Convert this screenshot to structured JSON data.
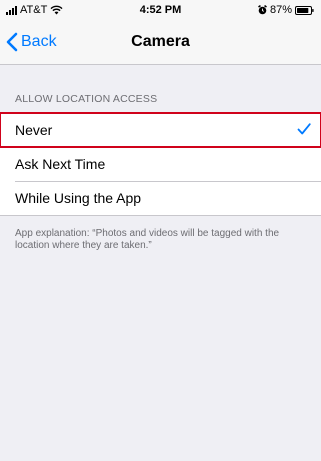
{
  "status_bar": {
    "carrier": "AT&T",
    "time": "4:52 PM",
    "battery_percent": "87%",
    "battery_level": 0.87
  },
  "nav": {
    "back_label": "Back",
    "title": "Camera"
  },
  "section": {
    "header": "ALLOW LOCATION ACCESS"
  },
  "options": [
    {
      "label": "Never",
      "selected": true
    },
    {
      "label": "Ask Next Time",
      "selected": false
    },
    {
      "label": "While Using the App",
      "selected": false
    }
  ],
  "footer": {
    "explanation": "App explanation: “Photos and videos will be tagged with the location where they are taken.”"
  },
  "colors": {
    "accent": "#007aff",
    "highlight_border": "#d0021b",
    "background": "#efeff4"
  },
  "icons": {
    "back": "chevron-left-icon",
    "selected": "checkmark-icon",
    "signal": "signal-icon",
    "wifi": "wifi-icon",
    "alarm": "alarm-icon",
    "battery": "battery-icon"
  }
}
